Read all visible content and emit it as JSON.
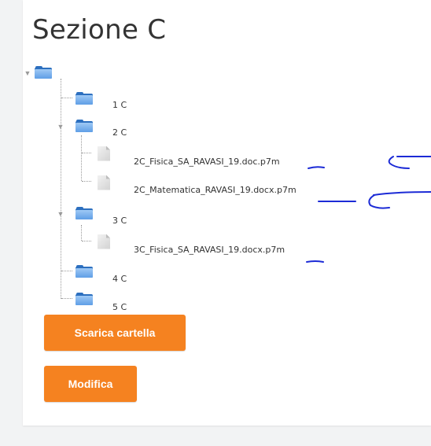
{
  "section": {
    "title": "Sezione C"
  },
  "tree": {
    "root": {
      "label": ""
    },
    "children": [
      {
        "label": "1 C"
      },
      {
        "label": "2 C",
        "files": [
          "2C_Fisica_SA_RAVASI_19.doc.p7m",
          "2C_Matematica_RAVASI_19.docx.p7m"
        ]
      },
      {
        "label": "3 C",
        "files": [
          "3C_Fisica_SA_RAVASI_19.docx.p7m"
        ]
      },
      {
        "label": "4 C"
      },
      {
        "label": "5 C"
      }
    ]
  },
  "buttons": {
    "download_label": "Scarica cartella",
    "edit_label": "Modifica"
  },
  "colors": {
    "accent": "#f58220",
    "folder": "#5f9ee6",
    "annotation_ink": "#1c2bd6"
  }
}
